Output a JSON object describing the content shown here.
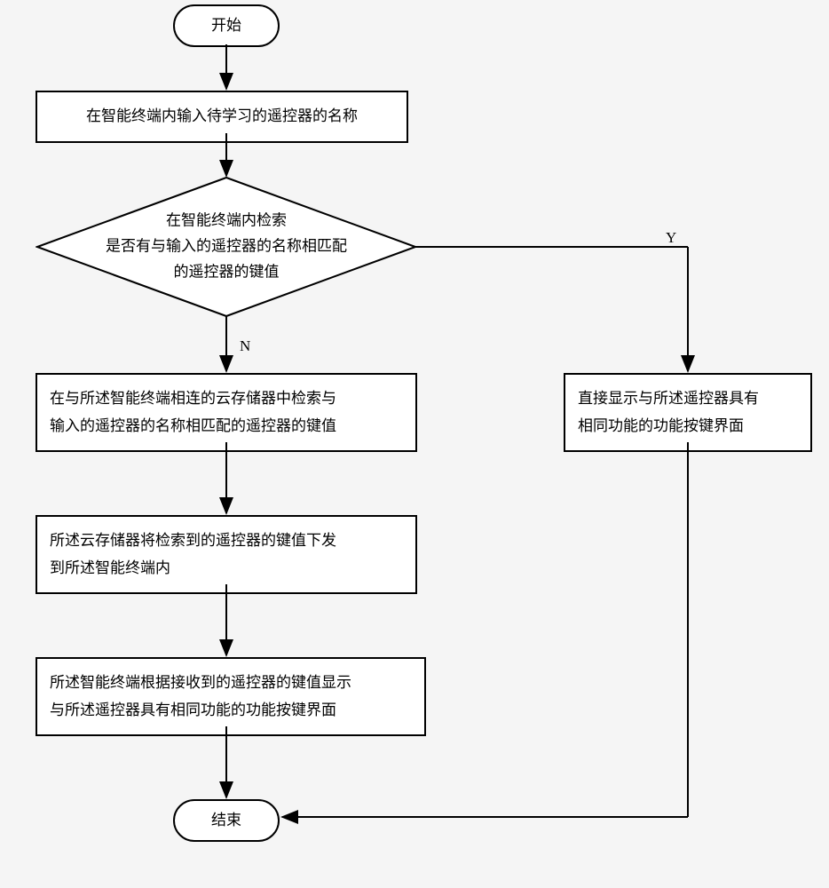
{
  "nodes": {
    "start": "开始",
    "input_name": "在智能终端内输入待学习的遥控器的名称",
    "decision_l1": "在智能终端内检索",
    "decision_l2": "是否有与输入的遥控器的名称相匹配",
    "decision_l3": "的遥控器的键值",
    "cloud_retrieve_l1": "在与所述智能终端相连的云存储器中检索与",
    "cloud_retrieve_l2": "输入的遥控器的名称相匹配的遥控器的键值",
    "yes_branch_l1": "直接显示与所述遥控器具有",
    "yes_branch_l2": "相同功能的功能按键界面",
    "dispatch_l1": "所述云存储器将检索到的遥控器的键值下发",
    "dispatch_l2": "到所述智能终端内",
    "display_l1": "所述智能终端根据接收到的遥控器的键值显示",
    "display_l2": "与所述遥控器具有相同功能的功能按键界面",
    "end": "结束"
  },
  "labels": {
    "yes": "Y",
    "no": "N"
  }
}
